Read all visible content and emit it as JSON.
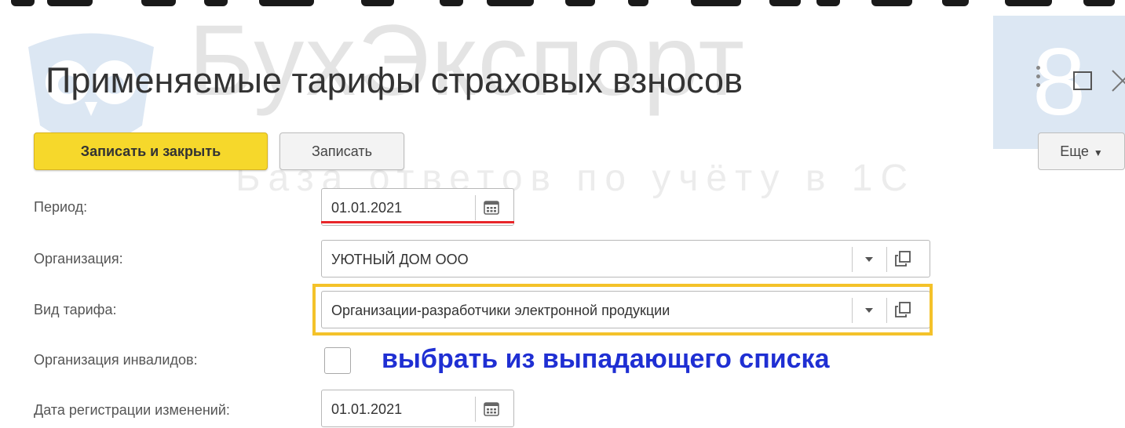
{
  "watermark": {
    "brand": "БухЭкспорт",
    "subtitle": "База ответов по учёту в 1С",
    "badge": "8"
  },
  "window": {
    "title": "Применяемые тарифы страховых взносов",
    "more_icon": "vertical-dots-icon",
    "maximize_icon": "maximize-icon",
    "close_icon": "close-icon"
  },
  "toolbar": {
    "save_close_label": "Записать и закрыть",
    "save_label": "Записать",
    "more_label": "Еще",
    "colors": {
      "primary": "#f6d82b"
    }
  },
  "form": {
    "period": {
      "label": "Период:",
      "value": "01.01.2021"
    },
    "organization": {
      "label": "Организация:",
      "value": "УЮТНЫЙ ДОМ ООО"
    },
    "tariff_type": {
      "label": "Вид тарифа:",
      "value": "Организации-разработчики электронной продукции"
    },
    "disabled_org": {
      "label": "Организация инвалидов:",
      "checked": false
    },
    "registration_date": {
      "label": "Дата регистрации изменений:",
      "value": "01.01.2021"
    }
  },
  "annotations": {
    "hint": "выбрать из выпадающего списка",
    "hint_color": "#1f2fd3",
    "underline_color": "#e8262a",
    "highlight_color": "#f4c22a"
  }
}
